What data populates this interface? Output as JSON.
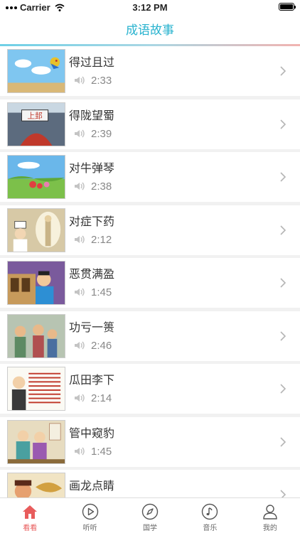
{
  "status": {
    "carrier": "Carrier",
    "time": "3:12 PM"
  },
  "nav": {
    "title": "成语故事"
  },
  "stories": [
    {
      "title": "得过且过",
      "duration": "2:33"
    },
    {
      "title": "得陇望蜀",
      "duration": "2:39"
    },
    {
      "title": "对牛弹琴",
      "duration": "2:38"
    },
    {
      "title": "对症下药",
      "duration": "2:12"
    },
    {
      "title": "恶贯满盈",
      "duration": "1:45"
    },
    {
      "title": "功亏一篑",
      "duration": "2:46"
    },
    {
      "title": "瓜田李下",
      "duration": "2:14"
    },
    {
      "title": "管中窥豹",
      "duration": "1:45"
    },
    {
      "title": "画龙点睛",
      "duration": ""
    }
  ],
  "thumbnail_texts": {
    "story_2_sign": "上邽"
  },
  "tabs": [
    {
      "label": "看看",
      "icon": "home-icon",
      "active": true
    },
    {
      "label": "听听",
      "icon": "play-icon",
      "active": false
    },
    {
      "label": "国学",
      "icon": "compass-icon",
      "active": false
    },
    {
      "label": "音乐",
      "icon": "music-icon",
      "active": false
    },
    {
      "label": "我的",
      "icon": "person-icon",
      "active": false
    }
  ],
  "colors": {
    "accent": "#29b3cf",
    "active_tab": "#e85c5c",
    "secondary_text": "#888888"
  }
}
